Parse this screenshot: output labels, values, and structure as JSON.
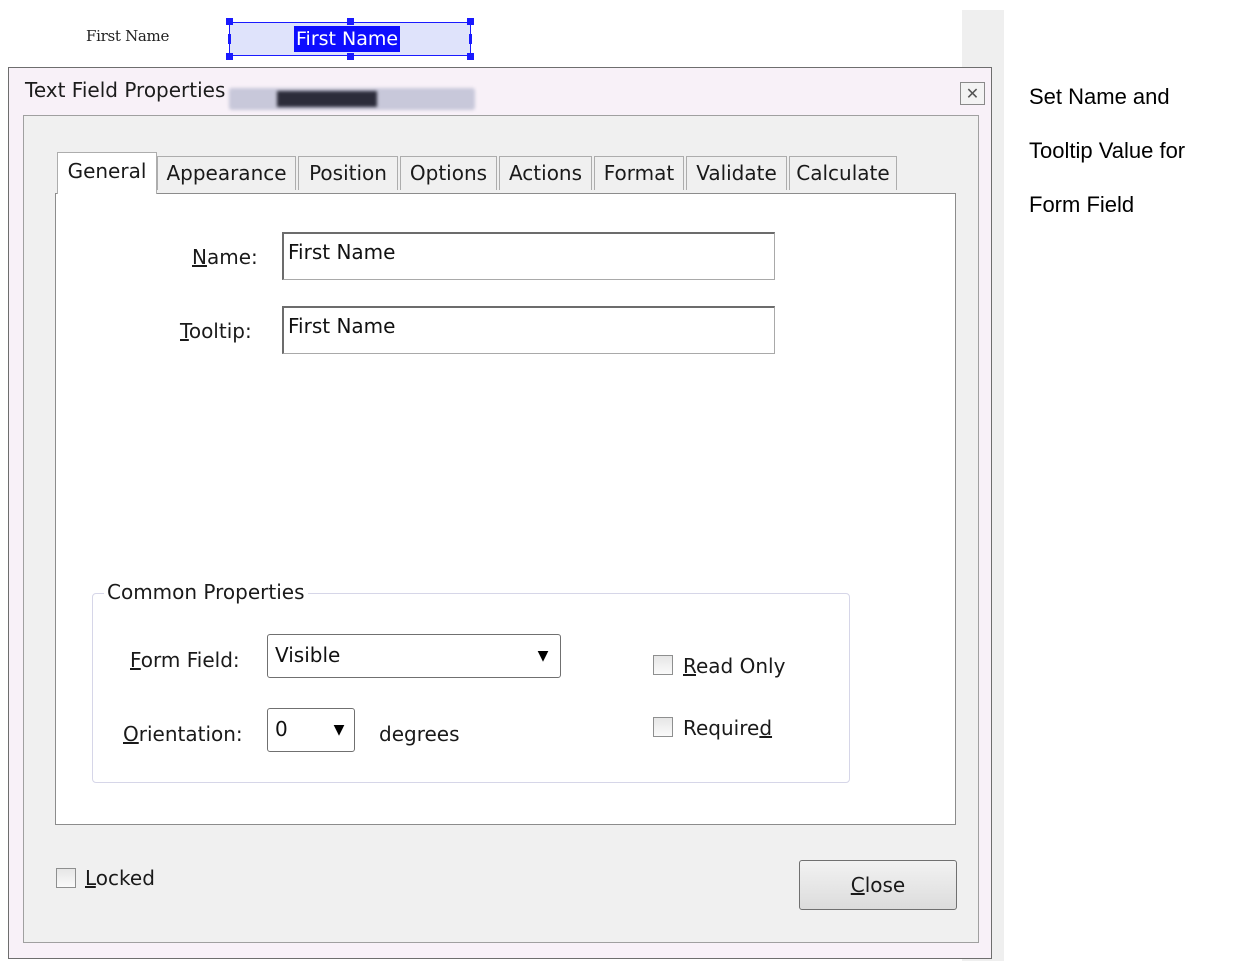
{
  "document": {
    "field_label": "First Name",
    "field_value": "First Name"
  },
  "dialog": {
    "title": "Text Field Properties",
    "close_icon": "close-icon",
    "tabs": [
      {
        "label": "General",
        "active": true
      },
      {
        "label": "Appearance",
        "active": false
      },
      {
        "label": "Position",
        "active": false
      },
      {
        "label": "Options",
        "active": false
      },
      {
        "label": "Actions",
        "active": false
      },
      {
        "label": "Format",
        "active": false
      },
      {
        "label": "Validate",
        "active": false
      },
      {
        "label": "Calculate",
        "active": false
      }
    ],
    "general": {
      "name_label_mnemonic": "N",
      "name_label_rest": "ame:",
      "name_value": "First Name",
      "tooltip_label_mnemonic": "T",
      "tooltip_label_rest": "ooltip:",
      "tooltip_value": "First Name",
      "common_properties": {
        "title": "Common Properties",
        "form_field_label_mnemonic": "F",
        "form_field_label_rest": "orm Field:",
        "form_field_value": "Visible",
        "orientation_label_mnemonic": "O",
        "orientation_label_rest": "rientation:",
        "orientation_value": "0",
        "orientation_unit": "degrees",
        "read_only_mnemonic": "R",
        "read_only_rest": "ead Only",
        "read_only_checked": false,
        "required_pre": "Require",
        "required_mnemonic": "d",
        "required_checked": false
      }
    },
    "locked_mnemonic": "L",
    "locked_rest": "ocked",
    "locked_checked": false,
    "close_mnemonic": "C",
    "close_rest": "lose"
  },
  "caption": {
    "line1": "Set Name and",
    "line2": "Tooltip Value for",
    "line3": "Form Field"
  },
  "colors": {
    "selection_blue": "#1a1aff",
    "highlight_blue": "#0d0dff",
    "field_fill": "#dfe3fb"
  }
}
